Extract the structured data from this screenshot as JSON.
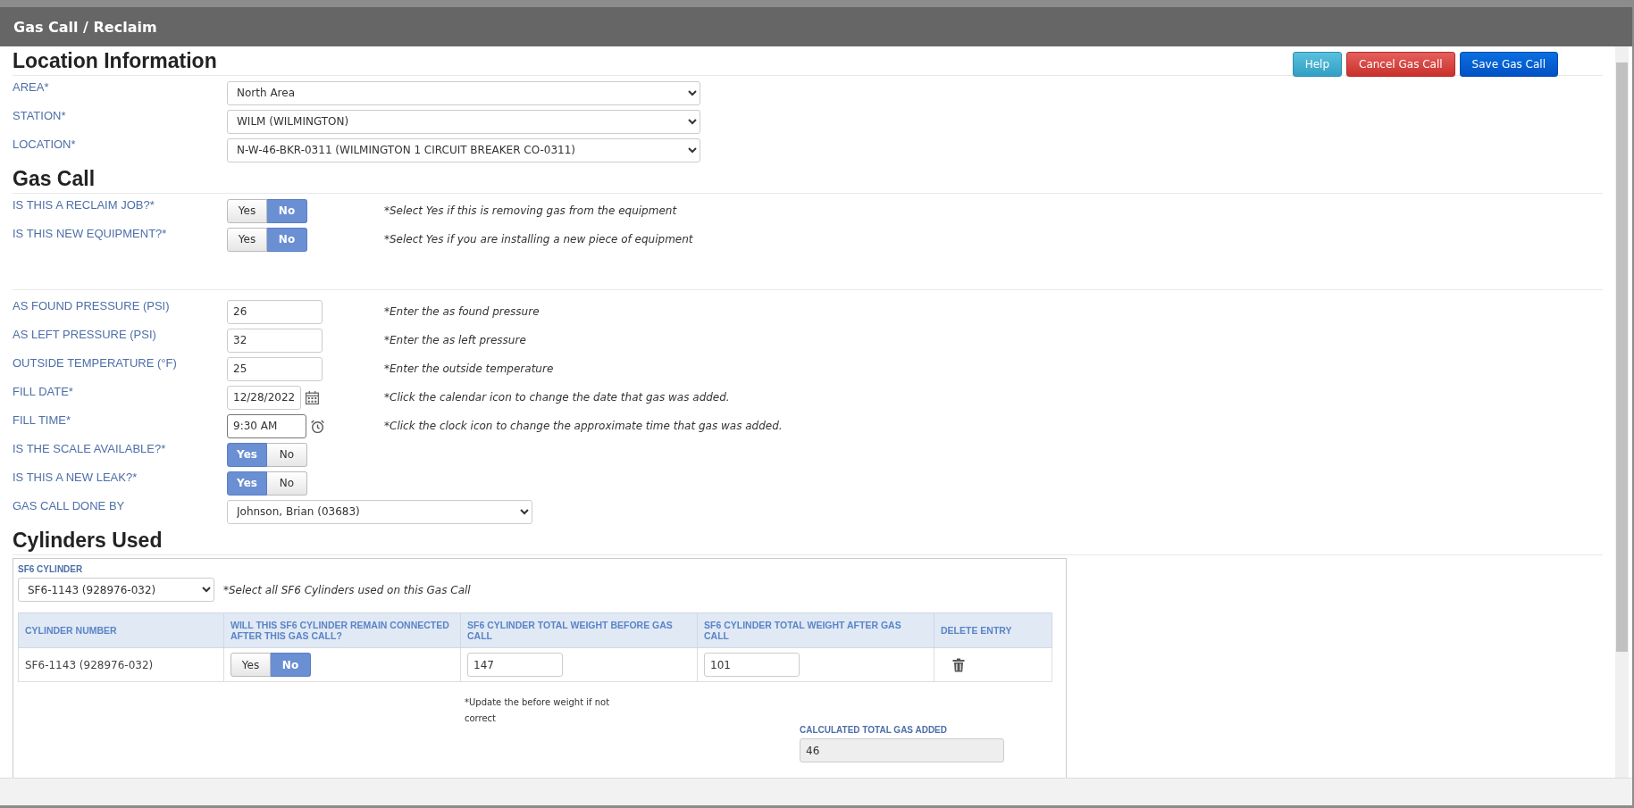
{
  "window": {
    "title": "Gas Call / Reclaim"
  },
  "buttons": [
    {
      "label": "Help",
      "kind": "info"
    },
    {
      "label": "Cancel Gas Call",
      "kind": "danger"
    },
    {
      "label": "Save Gas Call",
      "kind": "primary"
    }
  ],
  "sections": [
    {
      "heading": "Location Information",
      "fields": [
        {
          "kind": "select",
          "label": "AREA*",
          "value": "North Area"
        },
        {
          "kind": "select",
          "label": "STATION*",
          "value": "WILM (WILMINGTON)"
        },
        {
          "kind": "select",
          "label": "LOCATION*",
          "value": "N-W-46-BKR-0311 (WILMINGTON 1 CIRCUIT BREAKER CO-0311)"
        }
      ]
    },
    {
      "heading": "Gas Call",
      "fields": [
        {
          "kind": "toggle",
          "label": "IS THIS A RECLAIM JOB?*",
          "options": [
            {
              "label": "Yes",
              "selected": false
            },
            {
              "label": "No",
              "selected": true
            }
          ],
          "hint": "*Select Yes if this is removing gas from the equipment"
        },
        {
          "kind": "toggle",
          "label": "IS THIS NEW EQUIPMENT?*",
          "options": [
            {
              "label": "Yes",
              "selected": false
            },
            {
              "label": "No",
              "selected": true
            }
          ],
          "hint": "*Select Yes if you are installing a new piece of equipment"
        }
      ]
    },
    {
      "fields": [
        {
          "kind": "text",
          "label": "AS FOUND PRESSURE (PSI)",
          "value": "26",
          "hint": "*Enter the as found pressure"
        },
        {
          "kind": "text",
          "label": "AS LEFT PRESSURE (PSI)",
          "value": "32",
          "hint": "*Enter the as left pressure"
        },
        {
          "kind": "text",
          "label": "OUTSIDE TEMPERATURE (°F)",
          "value": "25",
          "hint": "*Enter the outside temperature"
        },
        {
          "kind": "date",
          "label": "FILL DATE*",
          "value": "12/28/2022",
          "hint": "*Click the calendar icon to change the date that gas was added."
        },
        {
          "kind": "time",
          "label": "FILL TIME*",
          "value": "9:30 AM",
          "hint": "*Click the clock icon to change the approximate time that gas was added."
        },
        {
          "kind": "toggle",
          "label": "IS THE SCALE AVAILABLE?*",
          "options": [
            {
              "label": "Yes",
              "selected": true
            },
            {
              "label": "No",
              "selected": false
            }
          ]
        },
        {
          "kind": "toggle",
          "label": "IS THIS A NEW LEAK?*",
          "options": [
            {
              "label": "Yes",
              "selected": true
            },
            {
              "label": "No",
              "selected": false
            }
          ]
        },
        {
          "kind": "person",
          "label": "GAS CALL DONE BY",
          "value": "Johnson, Brian (03683)"
        }
      ]
    }
  ],
  "cylinders": {
    "heading": "Cylinders Used",
    "select": {
      "label": "SF6 CYLINDER",
      "value": "SF6-1143 (928976-032)",
      "hint": "*Select all SF6 Cylinders used on this Gas Call"
    },
    "table": {
      "columns": [
        "CYLINDER NUMBER",
        "WILL THIS SF6 CYLINDER REMAIN CONNECTED AFTER THIS GAS CALL?",
        "SF6 CYLINDER TOTAL WEIGHT BEFORE GAS CALL",
        "SF6 CYLINDER TOTAL WEIGHT AFTER GAS CALL",
        "DELETE ENTRY"
      ],
      "rows": [
        {
          "cylinder": "SF6-1143 (928976-032)",
          "remain_connected": [
            {
              "label": "Yes",
              "selected": false
            },
            {
              "label": "No",
              "selected": true
            }
          ],
          "weight_before": "147",
          "weight_after": "101"
        }
      ]
    },
    "note": "*Update the before weight if not correct",
    "total": {
      "label": "CALCULATED TOTAL GAS ADDED",
      "value": "46"
    }
  }
}
